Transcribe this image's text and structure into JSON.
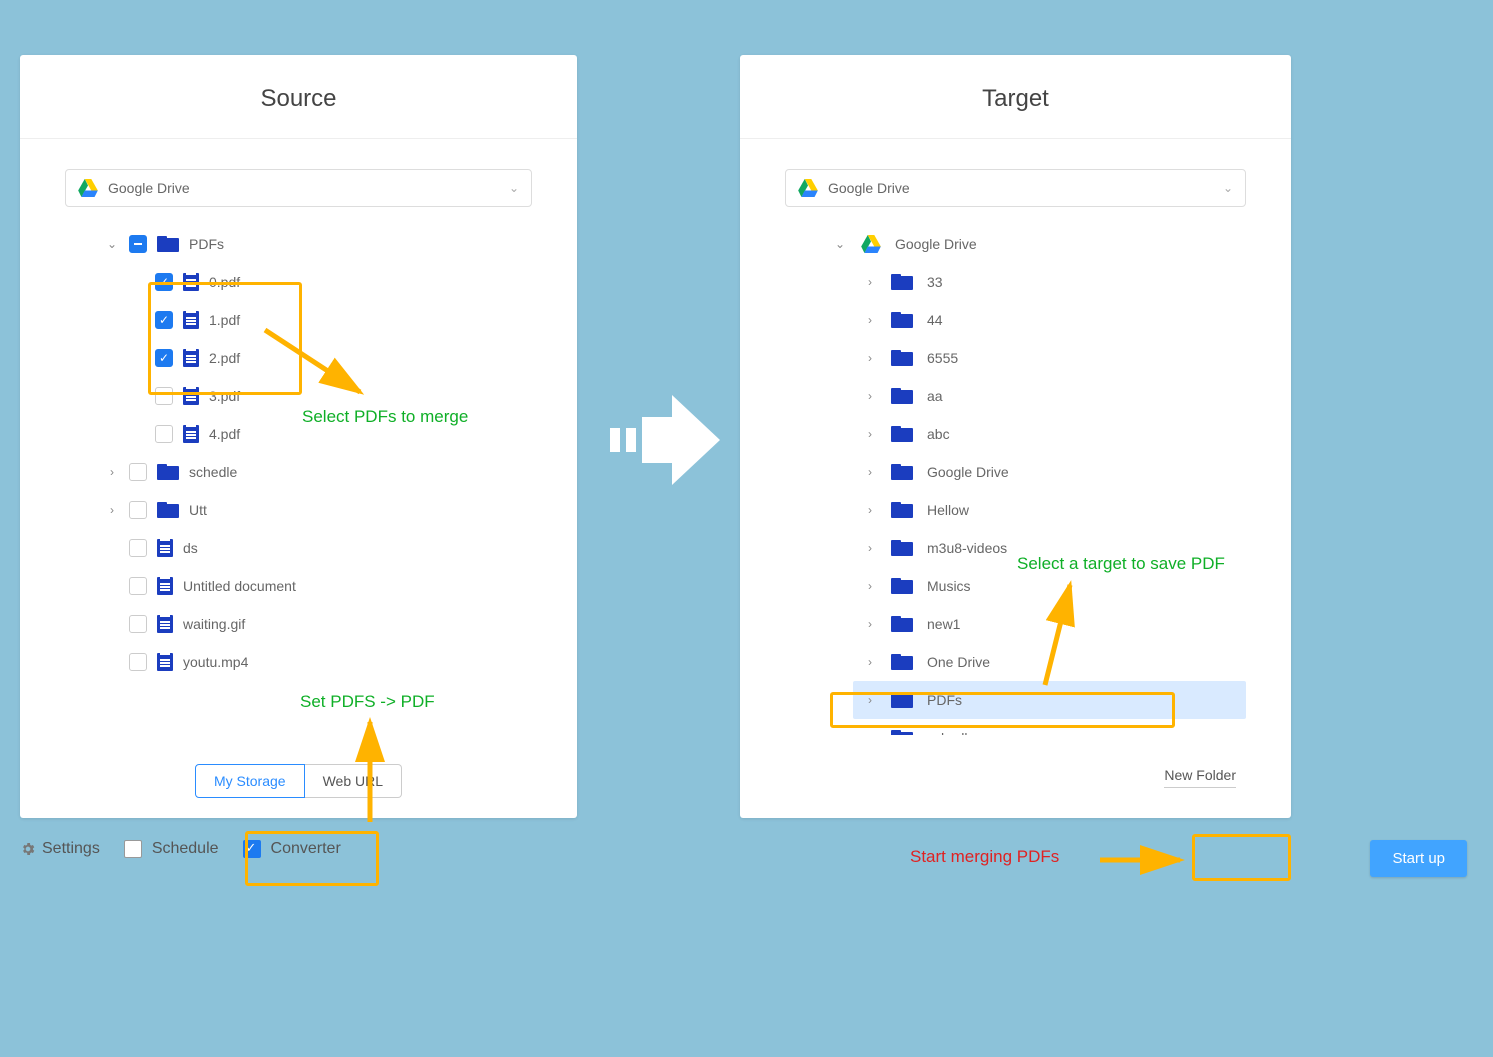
{
  "source": {
    "title": "Source",
    "drive_label": "Google Drive",
    "root_folder": "PDFs",
    "files": {
      "pdf0": "0.pdf",
      "pdf1": "1.pdf",
      "pdf2": "2.pdf",
      "pdf3": "3.pdf",
      "pdf4": "4.pdf"
    },
    "folders": {
      "schedle": "schedle",
      "utt": "Utt"
    },
    "items": {
      "ds": "ds",
      "untitled": "Untitled document",
      "waiting": "waiting.gif",
      "youtu": "youtu.mp4"
    },
    "tabs": {
      "mystorage": "My Storage",
      "weburl": "Web URL"
    }
  },
  "target": {
    "title": "Target",
    "drive_label": "Google Drive",
    "root_label": "Google Drive",
    "folders": [
      "33",
      "44",
      "6555",
      "aa",
      "abc",
      "Google Drive",
      "Hellow",
      "m3u8-videos",
      "Musics",
      "new1",
      "One Drive",
      "PDFs",
      "schedle"
    ],
    "new_folder": "New Folder"
  },
  "bottom": {
    "settings": "Settings",
    "schedule": "Schedule",
    "converter": "Converter",
    "startup": "Start up"
  },
  "annotations": {
    "select_pdfs": "Select PDFs to merge",
    "set_conv": "Set PDFS -> PDF",
    "select_target": "Select a target to save PDF",
    "start_merge": "Start merging PDFs"
  }
}
